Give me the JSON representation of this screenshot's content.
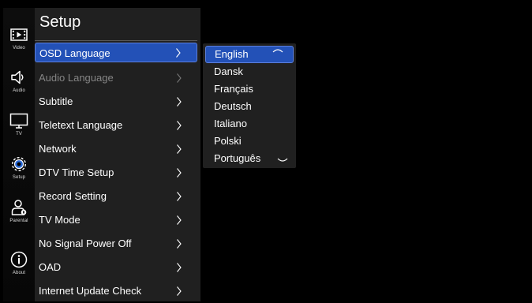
{
  "sidebar": {
    "items": [
      {
        "label": "Video",
        "icon": "video-icon"
      },
      {
        "label": "Audio",
        "icon": "audio-icon"
      },
      {
        "label": "TV",
        "icon": "tv-icon"
      },
      {
        "label": "Setup",
        "icon": "setup-icon"
      },
      {
        "label": "Parental",
        "icon": "parental-icon"
      },
      {
        "label": "About",
        "icon": "about-icon"
      }
    ]
  },
  "setup_menu": {
    "title": "Setup",
    "items": [
      {
        "label": "OSD Language",
        "state": "selected"
      },
      {
        "label": "Audio Language",
        "state": "disabled"
      },
      {
        "label": "Subtitle",
        "state": "normal"
      },
      {
        "label": "Teletext Language",
        "state": "normal"
      },
      {
        "label": "Network",
        "state": "normal"
      },
      {
        "label": "DTV Time Setup",
        "state": "normal"
      },
      {
        "label": "Record Setting",
        "state": "normal"
      },
      {
        "label": "TV Mode",
        "state": "normal"
      },
      {
        "label": "No Signal Power Off",
        "state": "normal"
      },
      {
        "label": "OAD",
        "state": "normal"
      },
      {
        "label": "Internet Update Check",
        "state": "normal"
      }
    ]
  },
  "language_dropdown": {
    "selected": "English",
    "options": [
      "English",
      "Dansk",
      "Français",
      "Deutsch",
      "Italiano",
      "Polski",
      "Português"
    ]
  },
  "colors": {
    "background": "#000000",
    "panel": "#202020",
    "selection": "#2351b7",
    "selection_border": "#5d80dc",
    "text": "#ffffff",
    "disabled_text": "#858585",
    "rule": "#5a5a5a"
  }
}
